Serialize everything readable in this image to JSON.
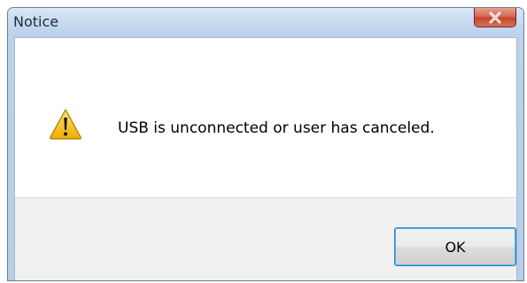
{
  "window": {
    "title": "Notice",
    "close_icon": "close-icon"
  },
  "message": {
    "icon": "warning-icon",
    "text": "USB is unconnected or user has canceled."
  },
  "buttons": {
    "ok_label": "OK"
  },
  "colors": {
    "close_button": "#c3442a",
    "warning_fill": "#f5c01e",
    "ok_focus_border": "#3c7fb1"
  }
}
